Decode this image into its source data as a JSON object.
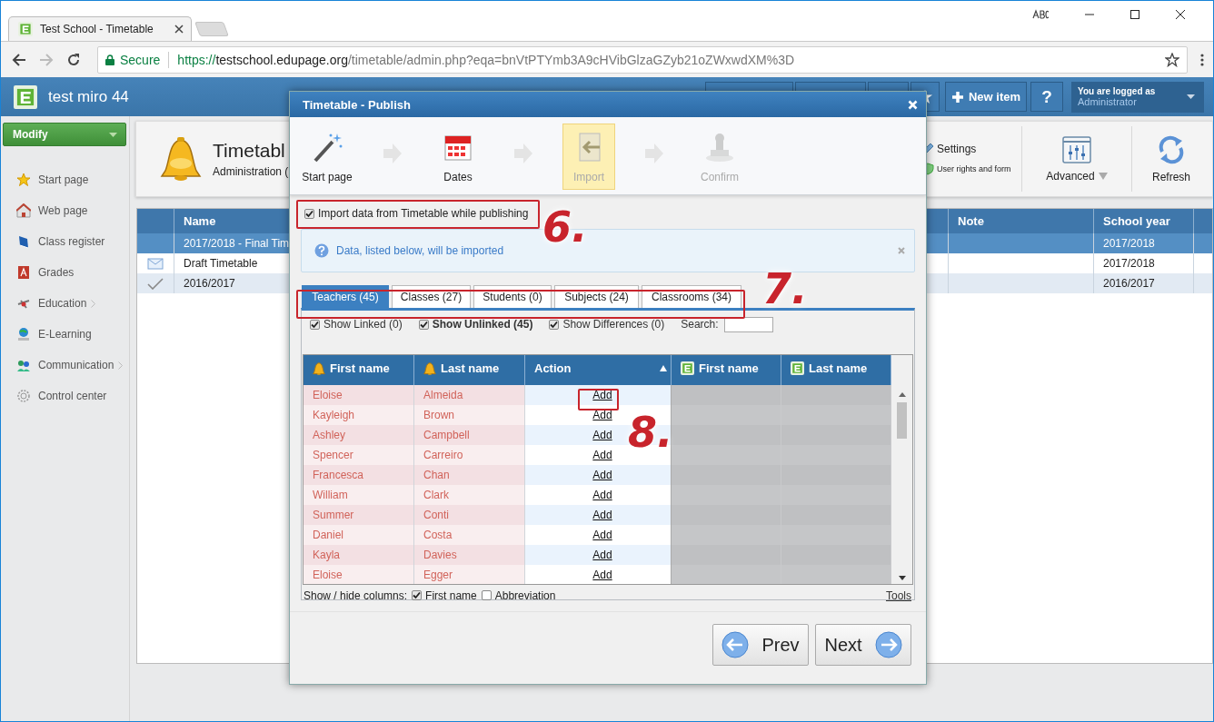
{
  "browser": {
    "tab_title": "Test School - Timetable",
    "secure": "Secure",
    "url_scheme": "https://",
    "url_host": "testschool.edupage.org",
    "url_path": "/timetable/admin.php?eqa=bnVtPTYmb3A9cHVibGlzaGZyb21oZWxwdXM%3D"
  },
  "header": {
    "school": "test miro 44",
    "new_item": "New item",
    "help": "?",
    "login_label": "You are logged as",
    "login_user": "Administrator"
  },
  "sidebar": {
    "modify": "Modify",
    "items": [
      {
        "label": "Start page",
        "has_submenu": false
      },
      {
        "label": "Web page",
        "has_submenu": false
      },
      {
        "label": "Class register",
        "has_submenu": false
      },
      {
        "label": "Grades",
        "has_submenu": false
      },
      {
        "label": "Education",
        "has_submenu": true
      },
      {
        "label": "E-Learning",
        "has_submenu": false
      },
      {
        "label": "Communication",
        "has_submenu": true
      },
      {
        "label": "Control center",
        "has_submenu": false
      }
    ]
  },
  "page_header": {
    "title": "Timetabl",
    "subtitle": "Administration (",
    "settings": "Settings",
    "user_rights": "User rights and form",
    "advanced": "Advanced",
    "refresh": "Refresh"
  },
  "table": {
    "columns": [
      "Name",
      "Note",
      "School year"
    ],
    "rows": [
      {
        "name": "2017/2018 - Final Tim",
        "school_year": "2017/2018",
        "selected": true
      },
      {
        "name": "Draft Timetable",
        "school_year": "2017/2018",
        "selected": false
      },
      {
        "name": "2016/2017",
        "school_year": "2016/2017",
        "selected": false
      }
    ]
  },
  "dialog": {
    "title": "Timetable - Publish",
    "steps": [
      {
        "label": "Start page",
        "selected": false,
        "disabled": false
      },
      {
        "label": "Dates",
        "selected": false,
        "disabled": false
      },
      {
        "label": "Import",
        "selected": true,
        "disabled": false
      },
      {
        "label": "Confirm",
        "selected": false,
        "disabled": true
      }
    ],
    "import_option": {
      "label": "Import data from Timetable while publishing",
      "checked": true
    },
    "info": "Data, listed below, will be imported",
    "tabs": [
      {
        "label": "Teachers (45)",
        "selected": true
      },
      {
        "label": "Classes (27)",
        "selected": false
      },
      {
        "label": "Students (0)",
        "selected": false
      },
      {
        "label": "Subjects (24)",
        "selected": false
      },
      {
        "label": "Classrooms (34)",
        "selected": false
      }
    ],
    "filters": [
      {
        "label": "Show Linked",
        "count": "(0)",
        "checked": true,
        "active": false
      },
      {
        "label": "Show Unlinked",
        "count": "(45)",
        "checked": true,
        "active": true
      },
      {
        "label": "Show Differences",
        "count": "(0)",
        "checked": true,
        "active": false
      }
    ],
    "search_label": "Search:",
    "grid": {
      "columns": [
        {
          "label": "First name",
          "kind": "timetable"
        },
        {
          "label": "Last name",
          "kind": "timetable"
        },
        {
          "label": "Action",
          "kind": "action",
          "sorted": true
        },
        {
          "label": "First name",
          "kind": "edupage"
        },
        {
          "label": "Last name",
          "kind": "edupage"
        }
      ],
      "rows": [
        {
          "first_name": "Eloise",
          "last_name": "Almeida",
          "action": "Add"
        },
        {
          "first_name": "Kayleigh",
          "last_name": "Brown",
          "action": "Add"
        },
        {
          "first_name": "Ashley",
          "last_name": "Campbell",
          "action": "Add"
        },
        {
          "first_name": "Spencer",
          "last_name": "Carreiro",
          "action": "Add"
        },
        {
          "first_name": "Francesca",
          "last_name": "Chan",
          "action": "Add"
        },
        {
          "first_name": "William",
          "last_name": "Clark",
          "action": "Add"
        },
        {
          "first_name": "Summer",
          "last_name": "Conti",
          "action": "Add"
        },
        {
          "first_name": "Daniel",
          "last_name": "Costa",
          "action": "Add"
        },
        {
          "first_name": "Kayla",
          "last_name": "Davies",
          "action": "Add"
        },
        {
          "first_name": "Eloise",
          "last_name": "Egger",
          "action": "Add"
        }
      ]
    },
    "columns_label": "Show / hide columns:",
    "column_toggles": [
      {
        "label": "First name",
        "checked": true
      },
      {
        "label": "Abbreviation",
        "checked": false
      }
    ],
    "tools": "Tools",
    "prev": "Prev",
    "next": "Next"
  },
  "annotations": [
    {
      "label": "6."
    },
    {
      "label": "7."
    },
    {
      "label": "8."
    }
  ]
}
